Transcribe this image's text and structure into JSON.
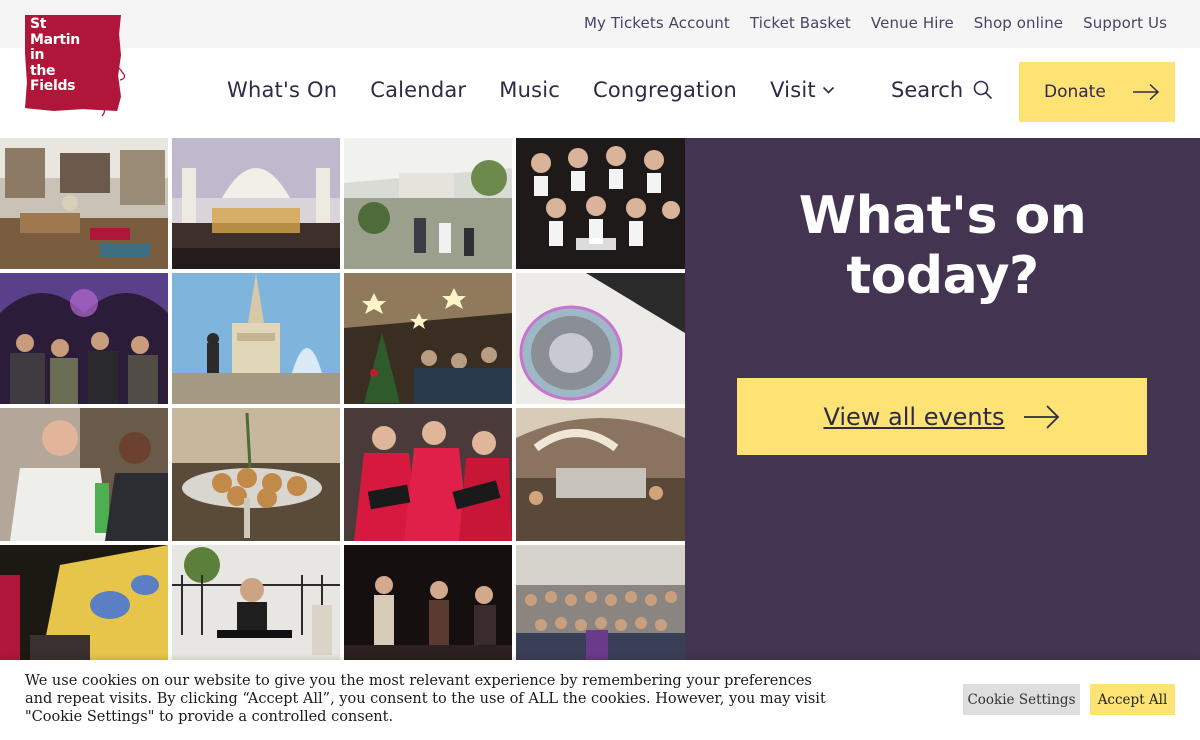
{
  "utility_nav": {
    "links": [
      "My Tickets Account",
      "Ticket Basket",
      "Venue Hire",
      "Shop online",
      "Support Us"
    ]
  },
  "logo": {
    "lines": [
      "St",
      "Martin",
      "in",
      "the",
      "Fields"
    ],
    "color": "#b0163a"
  },
  "main_nav": {
    "items": [
      "What's On",
      "Calendar",
      "Music",
      "Congregation",
      "Visit"
    ],
    "search_label": "Search",
    "donate_label": "Donate"
  },
  "photos": [
    {
      "name": "shop-photo",
      "icon": "gift-shop"
    },
    {
      "name": "church-interior-concert-photo",
      "icon": "church-interior"
    },
    {
      "name": "courtyard-cafe-photo",
      "icon": "courtyard"
    },
    {
      "name": "choir-in-tuxedos-photo",
      "icon": "choir"
    },
    {
      "name": "crypt-party-photo",
      "icon": "crowd"
    },
    {
      "name": "church-spire-fountain-photo",
      "icon": "landmark"
    },
    {
      "name": "christmas-market-photo",
      "icon": "christmas"
    },
    {
      "name": "east-window-photo",
      "icon": "window"
    },
    {
      "name": "priest-greeting-photo",
      "icon": "priest"
    },
    {
      "name": "mince-pies-photo",
      "icon": "food"
    },
    {
      "name": "red-robed-choir-photo",
      "icon": "choir"
    },
    {
      "name": "crypt-cafe-photo",
      "icon": "cafe"
    },
    {
      "name": "church-projection-photo",
      "icon": "light-show"
    },
    {
      "name": "keyboard-performer-photo",
      "icon": "performer"
    },
    {
      "name": "jazz-band-photo",
      "icon": "band"
    },
    {
      "name": "congregation-group-photo",
      "icon": "congregation"
    }
  ],
  "hero": {
    "title_line1": "What's on",
    "title_line2": "today?",
    "button_label": "View all events",
    "background_color": "#433552",
    "accent_color": "#fde374"
  },
  "cookie_banner": {
    "text": "We use cookies on our website to give you the most relevant experience by remembering your preferences and repeat visits. By clicking “Accept All”, you consent to the use of ALL the cookies. However, you may visit \"Cookie Settings\" to provide a controlled consent.",
    "settings_label": "Cookie Settings",
    "accept_label": "Accept All"
  }
}
